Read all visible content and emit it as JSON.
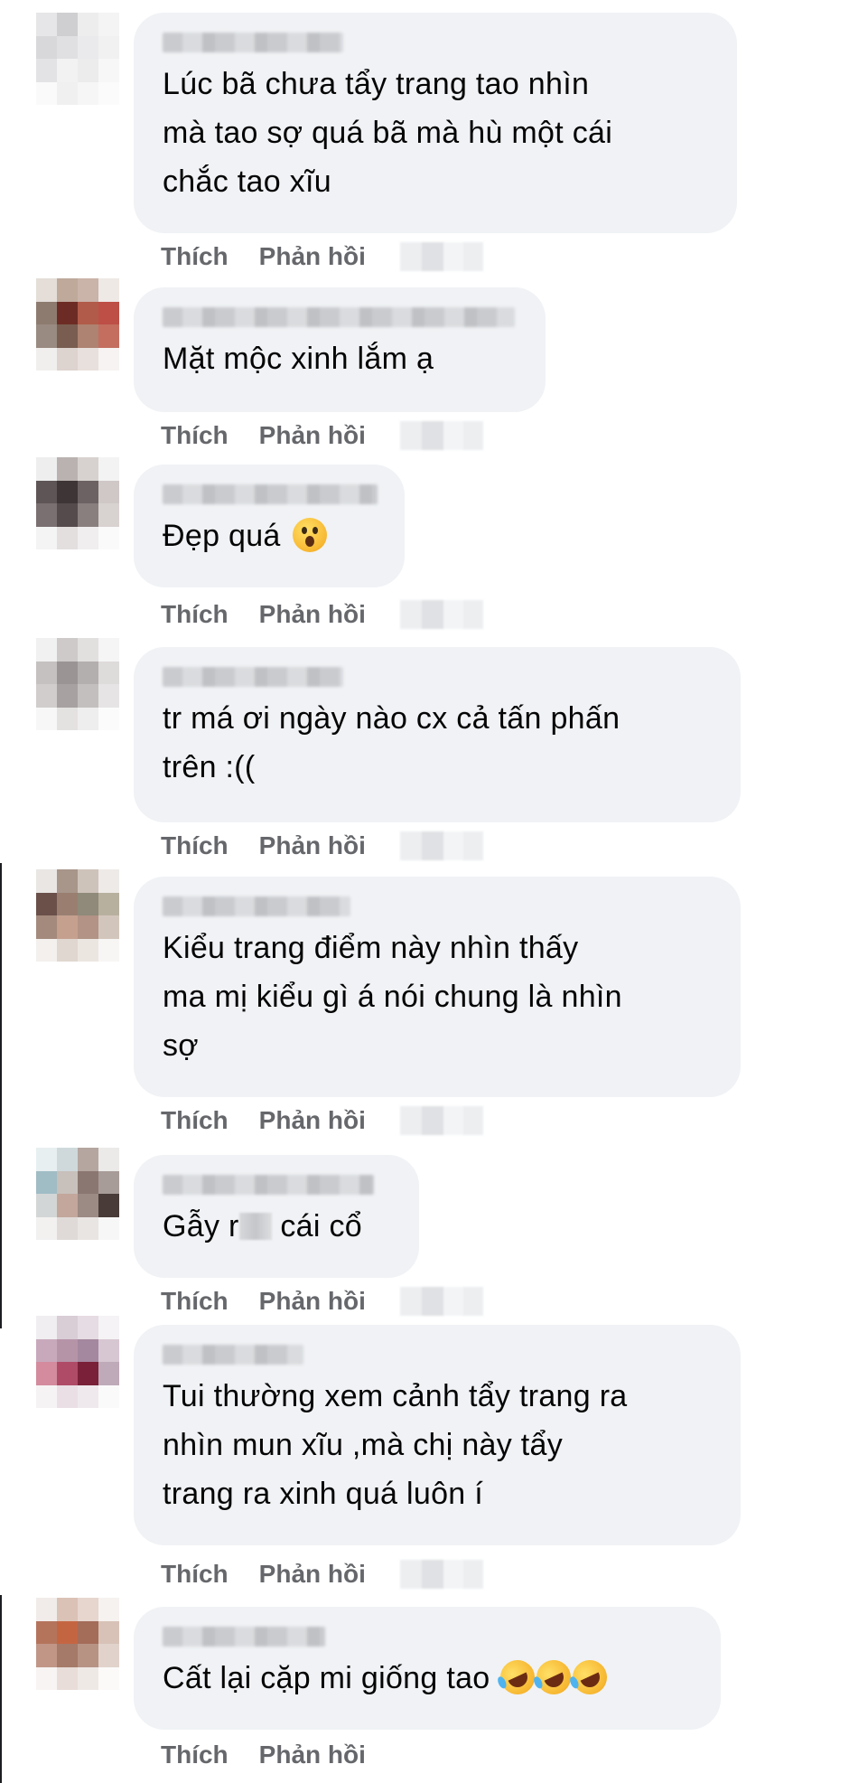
{
  "actions": {
    "like": "Thích",
    "reply": "Phản hồi"
  },
  "comments": [
    {
      "lines": "Lúc bã chưa tẩy trang tao nhìn\nmà tao sợ quá bã mà hù một cái\nchắc tao xĩu"
    },
    {
      "lines": "Mặt mộc xinh lắm ạ"
    },
    {
      "before": "Đẹp quá",
      "emoji": "astonished-face-icon"
    },
    {
      "lines": "tr má ơi ngày nào cx cả tấn phấn\ntrên :(("
    },
    {
      "lines": "Kiểu trang điểm này nhìn thấy\nma mị kiểu gì á nói chung là nhìn\nsợ"
    },
    {
      "before": "Gẫy r",
      "after": "cái cổ"
    },
    {
      "lines": "Tui thường xem cảnh tẩy trang ra\nnhìn mun xĩu ,mà chị này tẩy\ntrang ra xinh quá luôn í"
    },
    {
      "before": "Cất lại cặp mi giống tao",
      "emoji": "rolling-on-floor-laughing-icon"
    }
  ],
  "colors": {
    "bubble": "#f0f2f5",
    "text": "#050505",
    "action": "#65676b"
  }
}
